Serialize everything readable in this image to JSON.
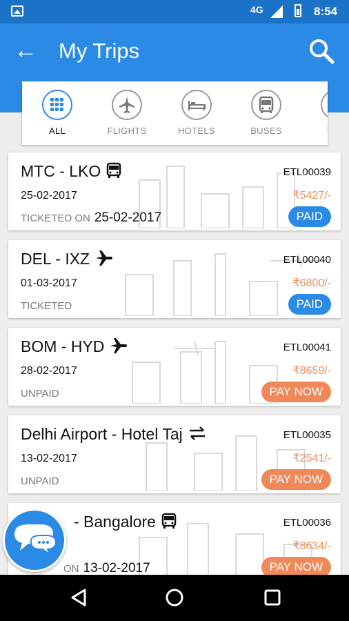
{
  "status_bar": {
    "network": "4G",
    "time": "8:54"
  },
  "app_bar": {
    "title": "My Trips"
  },
  "categories": [
    {
      "label": "ALL",
      "icon": "grid-icon",
      "active": true
    },
    {
      "label": "FLIGHTS",
      "icon": "airplane-icon",
      "active": false
    },
    {
      "label": "HOTELS",
      "icon": "bed-icon",
      "active": false
    },
    {
      "label": "BUSES",
      "icon": "bus-icon",
      "active": false
    },
    {
      "label": "TRA",
      "icon": "train-icon",
      "active": false
    }
  ],
  "trips": [
    {
      "route": "MTC - LKO",
      "type_icon": "bus-icon",
      "date": "25-02-2017",
      "status": "TICKETED ON",
      "status_date": "25-02-2017",
      "ref": "ETL00039",
      "price": "₹5427/-",
      "badge": "PAID"
    },
    {
      "route": "DEL - IXZ",
      "type_icon": "airplane-icon",
      "date": "01-03-2017",
      "status": "TICKETED",
      "status_date": "",
      "ref": "ETL00040",
      "price": "₹6800/-",
      "badge": "PAID"
    },
    {
      "route": "BOM - HYD",
      "type_icon": "airplane-icon",
      "date": "28-02-2017",
      "status": "UNPAID",
      "status_date": "",
      "ref": "ETL00041",
      "price": "₹8659/-",
      "badge": "PAY NOW"
    },
    {
      "route": "Delhi Airport - Hotel Taj",
      "type_icon": "transfer-icon",
      "date": "13-02-2017",
      "status": "UNPAID",
      "status_date": "",
      "ref": "ETL00035",
      "price": "₹2541/-",
      "badge": "PAY NOW"
    },
    {
      "route": "- Bangalore",
      "type_icon": "bus-icon",
      "date": "",
      "status": "ON",
      "status_date": "13-02-2017",
      "ref": "ETL00036",
      "price": "₹8634/-",
      "badge": "PAY NOW"
    }
  ],
  "colors": {
    "primary": "#2a8ae6",
    "status_bar": "#1b73c8",
    "pay_now": "#f0895a",
    "price": "#f08d5a"
  }
}
